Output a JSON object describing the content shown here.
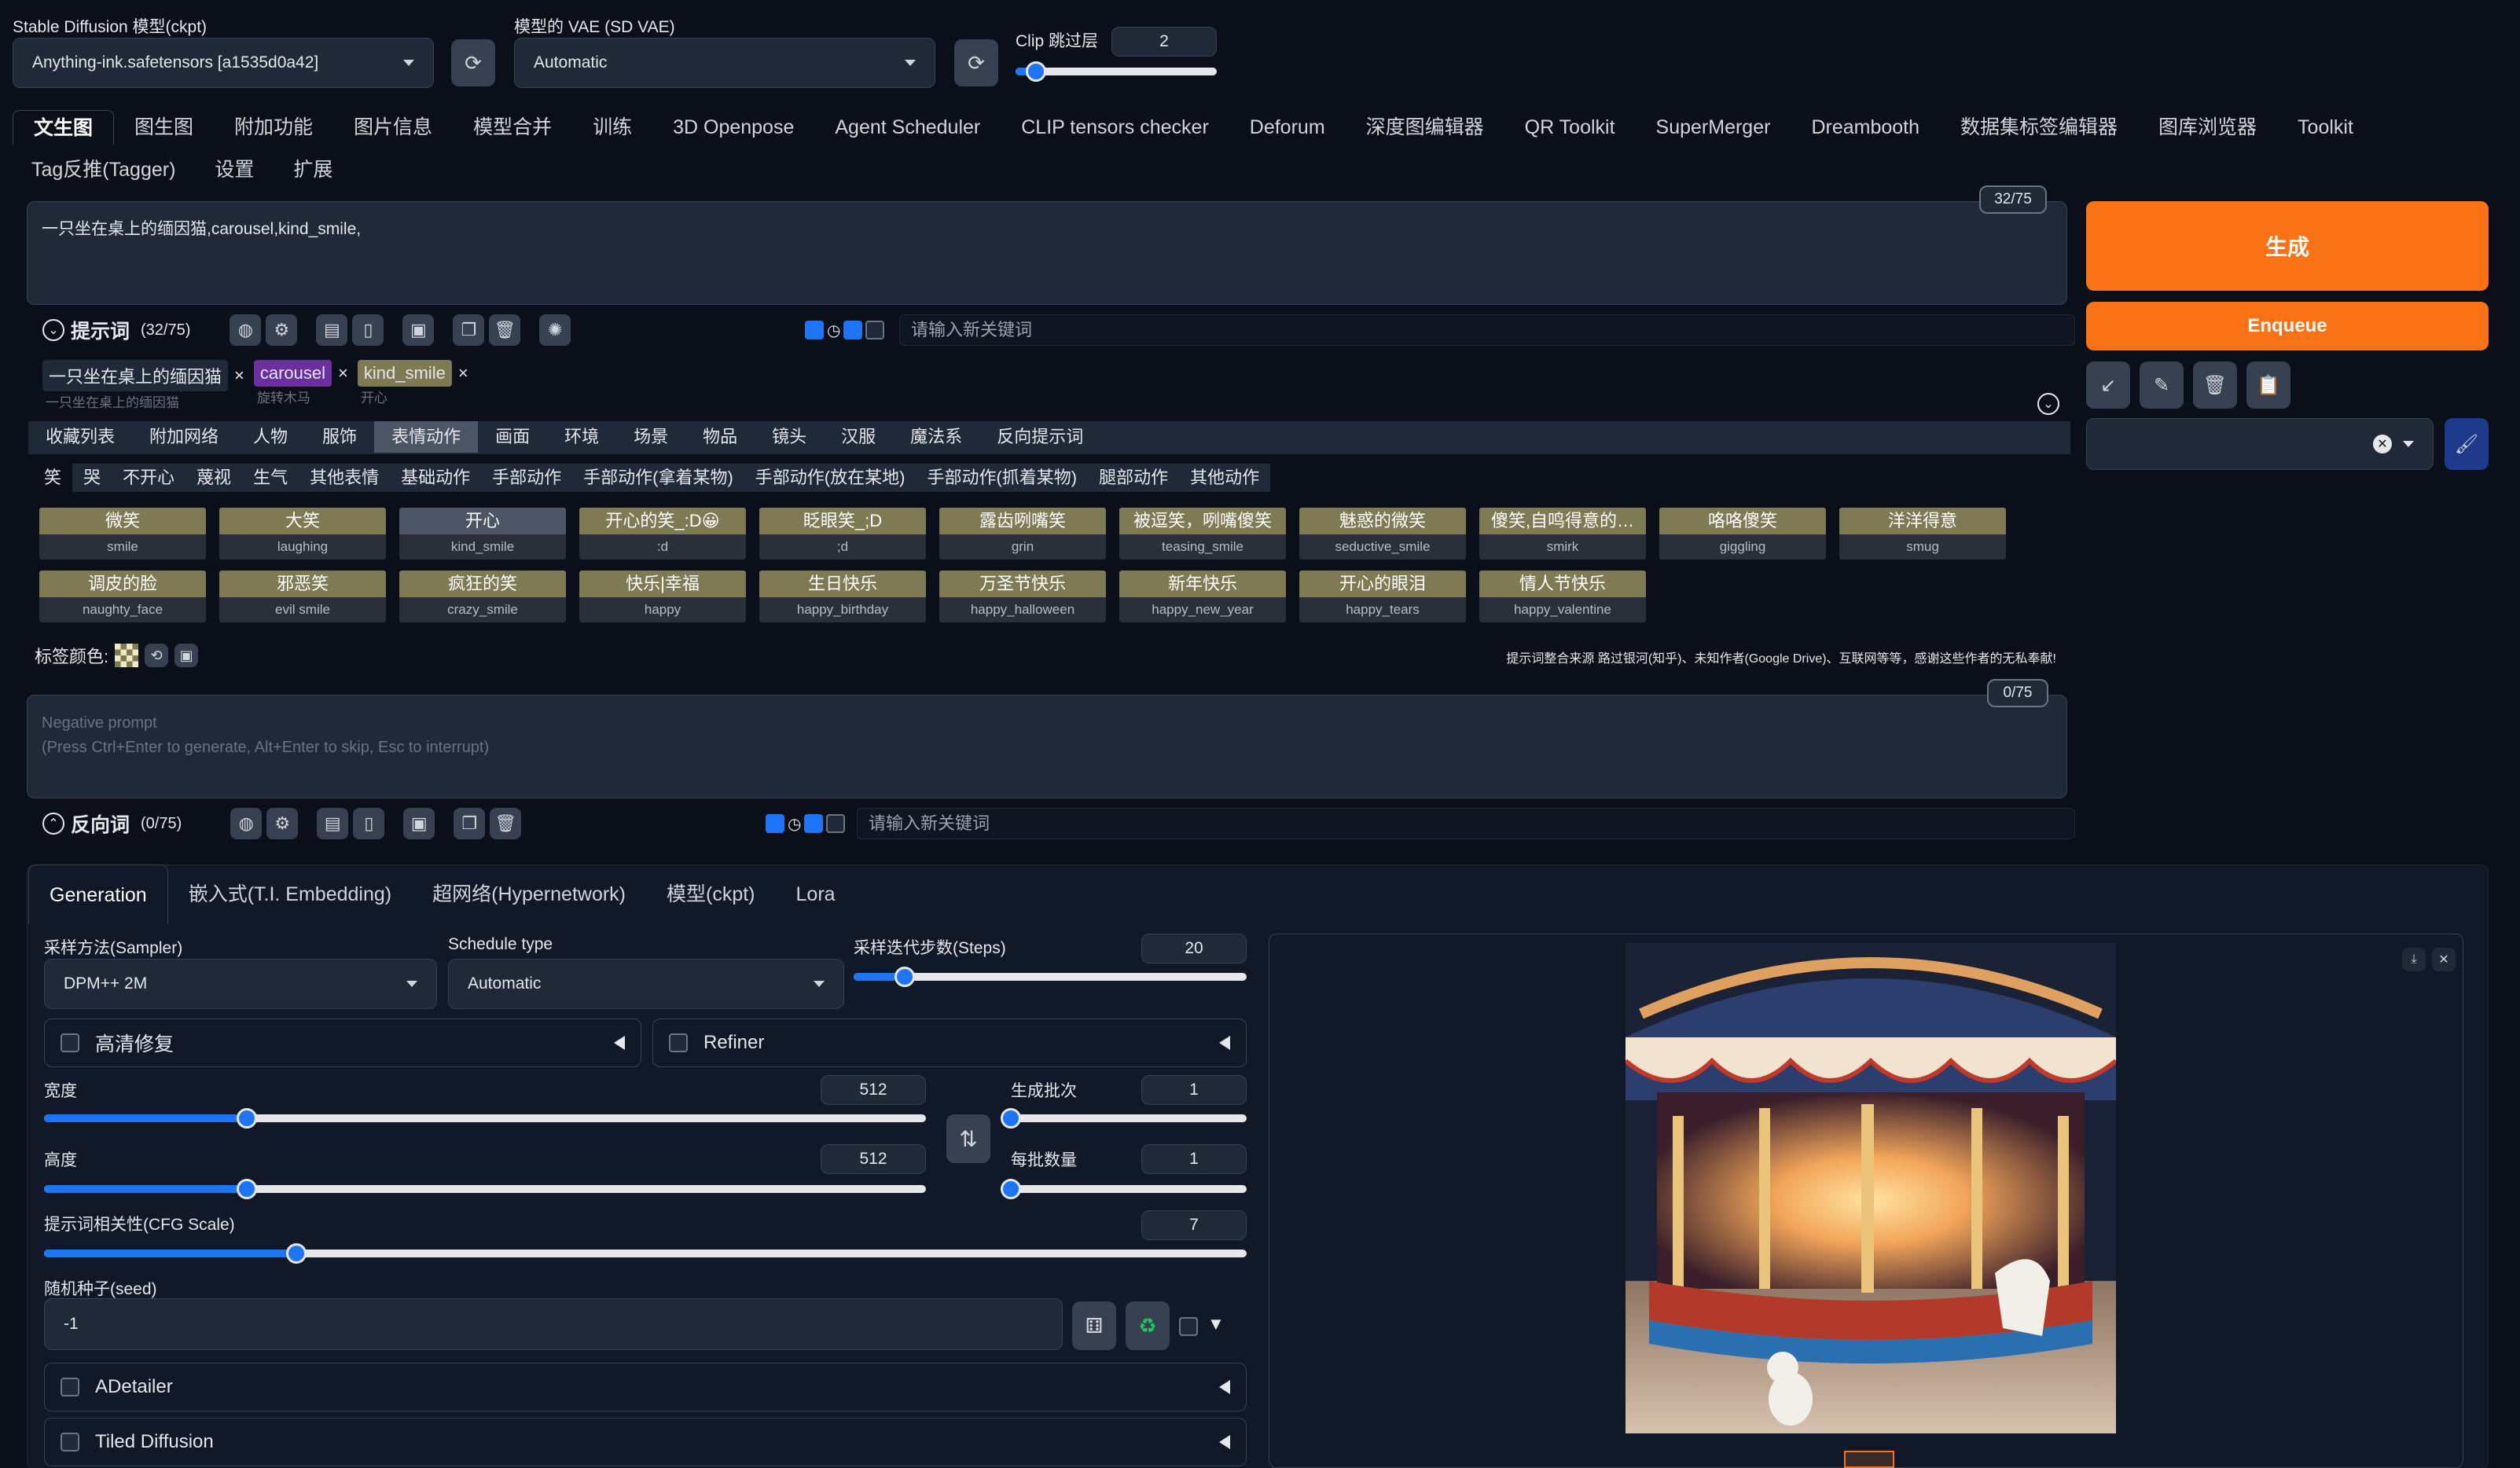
{
  "top": {
    "model_label": "Stable Diffusion 模型(ckpt)",
    "model_value": "Anything-ink.safetensors [a1535d0a42]",
    "vae_label": "模型的 VAE (SD VAE)",
    "vae_value": "Automatic",
    "clip_label": "Clip 跳过层",
    "clip_value": "2",
    "clip_fraction": 0.1
  },
  "tabs": [
    "文生图",
    "图生图",
    "附加功能",
    "图片信息",
    "模型合并",
    "训练",
    "3D Openpose",
    "Agent Scheduler",
    "CLIP tensors checker",
    "Deforum",
    "深度图编辑器",
    "QR Toolkit",
    "SuperMerger",
    "Dreambooth",
    "数据集标签编辑器",
    "图库浏览器",
    "Toolkit"
  ],
  "tabs2": [
    "Tag反推(Tagger)",
    "设置",
    "扩展"
  ],
  "prompt": {
    "text": "一只坐在桌上的缅因猫,carousel,kind_smile,",
    "counter": "32/75",
    "section_label": "提示词",
    "section_count": "(32/75)",
    "keyword_placeholder": "请输入新关键词"
  },
  "chips": [
    {
      "text": "一只坐在桌上的缅因猫",
      "sub": "一只坐在桌上的缅因猫",
      "color": "#1f2937"
    },
    {
      "text": "carousel",
      "sub": "旋转木马",
      "color": "#6b2fa0"
    },
    {
      "text": "kind_smile",
      "sub": "开心",
      "color": "#7d7a54"
    }
  ],
  "categories": [
    "收藏列表",
    "附加网络",
    "人物",
    "服饰",
    "表情动作",
    "画面",
    "环境",
    "场景",
    "物品",
    "镜头",
    "汉服",
    "魔法系",
    "反向提示词"
  ],
  "subcategories": [
    "笑",
    "哭",
    "不开心",
    "蔑视",
    "生气",
    "其他表情",
    "基础动作",
    "手部动作",
    "手部动作(拿着某物)",
    "手部动作(放在某地)",
    "手部动作(抓着某物)",
    "腿部动作",
    "其他动作"
  ],
  "tags_row1": [
    {
      "cn": "微笑",
      "en": "smile"
    },
    {
      "cn": "大笑",
      "en": "laughing"
    },
    {
      "cn": "开心",
      "en": "kind_smile",
      "selected": true
    },
    {
      "cn": "开心的笑_:D😀",
      "en": ":d"
    },
    {
      "cn": "眨眼笑_;D",
      "en": ";d"
    },
    {
      "cn": "露齿咧嘴笑",
      "en": "grin"
    },
    {
      "cn": "被逗笑，咧嘴傻笑",
      "en": "teasing_smile"
    },
    {
      "cn": "魅惑的微笑",
      "en": "seductive_smile"
    },
    {
      "cn": "傻笑,自鸣得意的…",
      "en": "smirk"
    },
    {
      "cn": "咯咯傻笑",
      "en": "giggling"
    },
    {
      "cn": "洋洋得意",
      "en": "smug"
    }
  ],
  "tags_row2": [
    {
      "cn": "调皮的脸",
      "en": "naughty_face"
    },
    {
      "cn": "邪恶笑",
      "en": "evil smile"
    },
    {
      "cn": "疯狂的笑",
      "en": "crazy_smile"
    },
    {
      "cn": "快乐|幸福",
      "en": "happy"
    },
    {
      "cn": "生日快乐",
      "en": "happy_birthday"
    },
    {
      "cn": "万圣节快乐",
      "en": "happy_halloween"
    },
    {
      "cn": "新年快乐",
      "en": "happy_new_year"
    },
    {
      "cn": "开心的眼泪",
      "en": "happy_tears"
    },
    {
      "cn": "情人节快乐",
      "en": "happy_valentine"
    }
  ],
  "tag_color_label": "标签颜色:",
  "credits": "提示词整合来源 路过银河(知乎)、未知作者(Google Drive)、互联网等等，感谢这些作者的无私奉献!",
  "negative": {
    "placeholder": "Negative prompt\n(Press Ctrl+Enter to generate, Alt+Enter to skip, Esc to interrupt)",
    "counter": "0/75",
    "section_label": "反向词",
    "section_count": "(0/75)",
    "keyword_placeholder": "请输入新关键词"
  },
  "right": {
    "generate": "生成",
    "enqueue": "Enqueue",
    "accent": "#f97316"
  },
  "gen_tabs": [
    "Generation",
    "嵌入式(T.I. Embedding)",
    "超网络(Hypernetwork)",
    "模型(ckpt)",
    "Lora"
  ],
  "params": {
    "sampler_label": "采样方法(Sampler)",
    "sampler_value": "DPM++ 2M",
    "schedule_label": "Schedule type",
    "schedule_value": "Automatic",
    "steps_label": "采样迭代步数(Steps)",
    "steps_value": "20",
    "steps_fraction": 0.13,
    "hires_label": "高清修复",
    "refiner_label": "Refiner",
    "width_label": "宽度",
    "width_value": "512",
    "width_fraction": 0.23,
    "height_label": "高度",
    "height_value": "512",
    "height_fraction": 0.23,
    "batch_count_label": "生成批次",
    "batch_count_value": "1",
    "batch_count_fraction": 0.0,
    "batch_size_label": "每批数量",
    "batch_size_value": "1",
    "batch_size_fraction": 0.0,
    "cfg_label": "提示词相关性(CFG Scale)",
    "cfg_value": "7",
    "cfg_fraction": 0.21,
    "seed_label": "随机种子(seed)",
    "seed_value": "-1",
    "adetailer_label": "ADetailer",
    "tiled_label": "Tiled Diffusion"
  }
}
